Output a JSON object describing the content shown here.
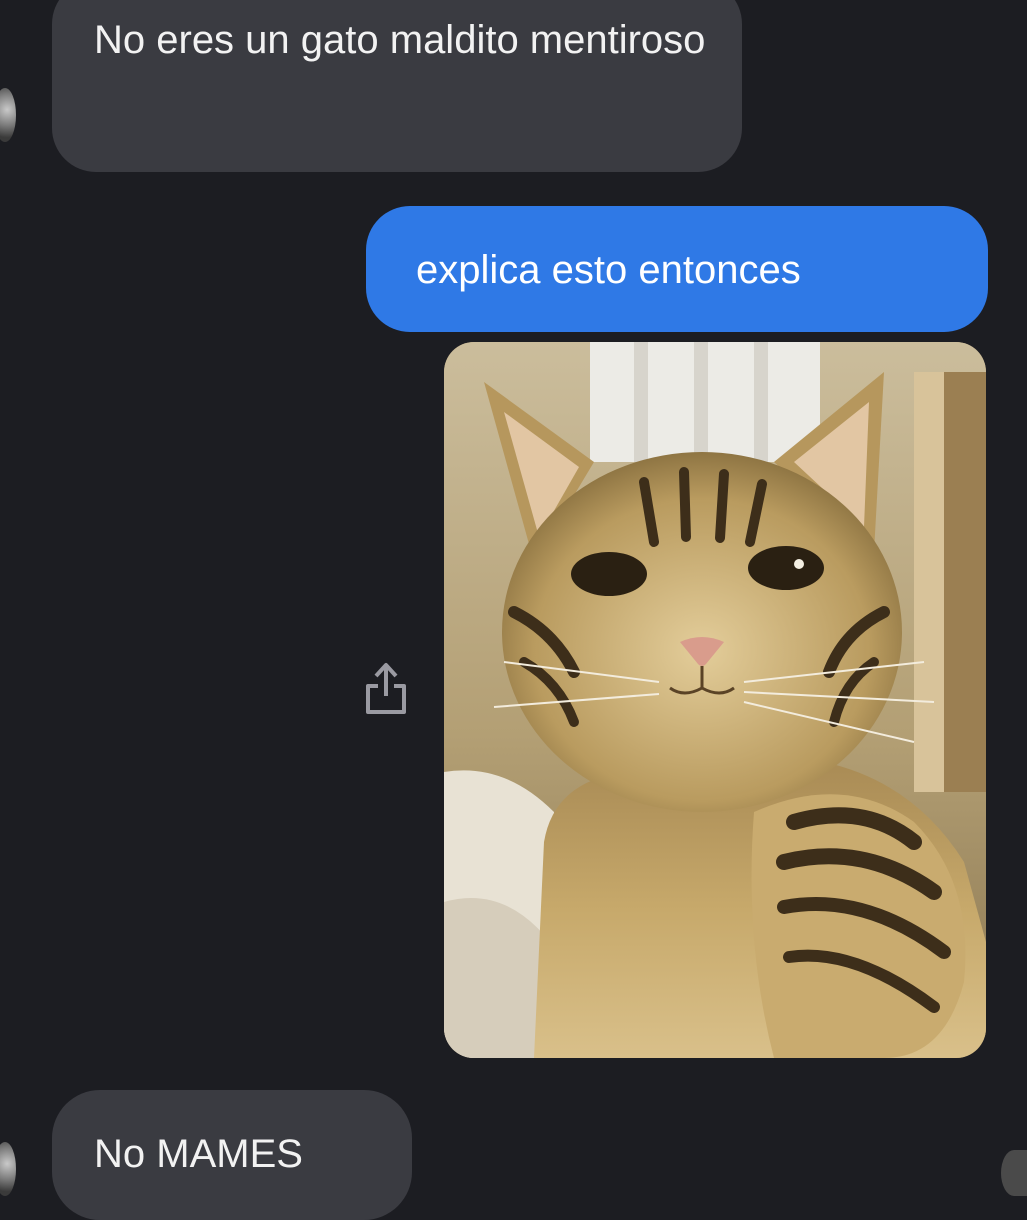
{
  "conversation": {
    "messages": [
      {
        "direction": "incoming",
        "text": "No eres un gato maldito mentiroso"
      },
      {
        "direction": "outgoing",
        "text": "explica esto entonces"
      },
      {
        "direction": "outgoing",
        "attachment": "photo of a tabby cat taking a selfie"
      },
      {
        "direction": "incoming",
        "text": "No MAMES"
      }
    ],
    "share_icon": "share-icon"
  },
  "colors": {
    "background": "#1c1d22",
    "incoming_bubble": "#3a3b41",
    "outgoing_bubble": "#2f79e6",
    "text": "#f2f2f2"
  }
}
